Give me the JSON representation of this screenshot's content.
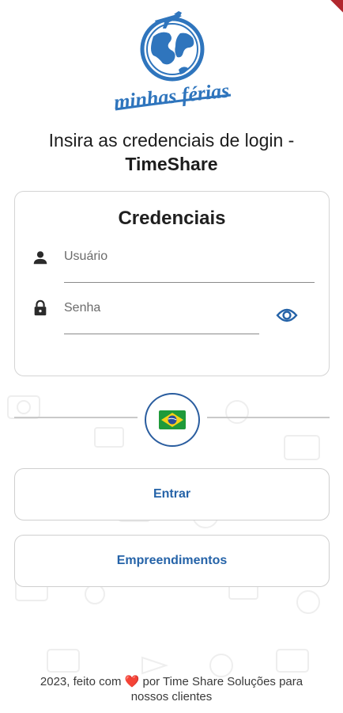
{
  "logo": {
    "text": "minhas férias"
  },
  "login": {
    "title_line1": "Insira as credenciais de login -",
    "title_line2": "TimeShare"
  },
  "credentials": {
    "title": "Credenciais",
    "username_placeholder": "Usuário",
    "password_placeholder": "Senha"
  },
  "language": {
    "flag": "🇧🇷"
  },
  "buttons": {
    "enter_label": "Entrar",
    "developments_label": "Empreendimentos"
  },
  "footer": {
    "prefix": "2023, feito com",
    "heart": "❤️",
    "suffix": "por Time Share Soluções para",
    "line2": "nossos clientes"
  },
  "colors": {
    "accent": "#2563a8",
    "logo_blue": "#2f75bd",
    "heart": "#e0322d"
  }
}
